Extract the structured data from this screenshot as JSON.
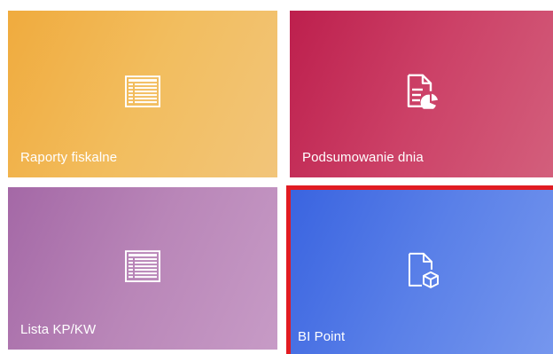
{
  "tiles": [
    {
      "id": "raporty-fiskalne",
      "label": "Raporty fiskalne",
      "icon": "list-table-icon",
      "color": "#f2bd5e"
    },
    {
      "id": "podsumowanie-dnia",
      "label": "Podsumowanie dnia",
      "icon": "document-chart-icon",
      "color": "#cc4167"
    },
    {
      "id": "lista-kp-kw",
      "label": "Lista KP/KW",
      "icon": "list-table-icon",
      "color": "#b986b8"
    },
    {
      "id": "bi-point",
      "label": "BI Point",
      "icon": "document-cube-icon",
      "color": "#5a80e8",
      "selected": true,
      "selection_color": "#e11b22"
    }
  ]
}
